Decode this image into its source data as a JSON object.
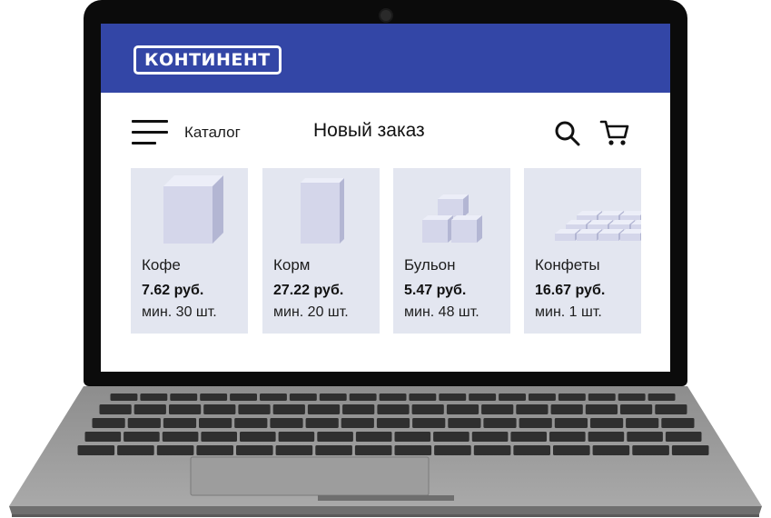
{
  "brand": {
    "logo_text": "КОНТИНЕНТ",
    "color": "#3346a6"
  },
  "toolbar": {
    "menu_icon": "hamburger-icon",
    "catalog_label": "Каталог",
    "title": "Новый заказ",
    "search_icon": "search-icon",
    "cart_icon": "cart-icon"
  },
  "products": [
    {
      "name": "Кофе",
      "price": "7.62 руб.",
      "min": "мин. 30 шт.",
      "icon": "tall-box-icon"
    },
    {
      "name": "Корм",
      "price": "27.22 руб.",
      "min": "мин. 20 шт.",
      "icon": "flat-box-icon"
    },
    {
      "name": "Бульон",
      "price": "5.47 руб.",
      "min": "мин. 48 шт.",
      "icon": "stacked-cubes-icon"
    },
    {
      "name": "Конфеты",
      "price": "16.67 руб.",
      "min": "мин. 1 шт.",
      "icon": "tile-grid-icon"
    }
  ],
  "colors": {
    "card_bg": "#e3e6f0",
    "box_fill": "#d4d6ea"
  }
}
